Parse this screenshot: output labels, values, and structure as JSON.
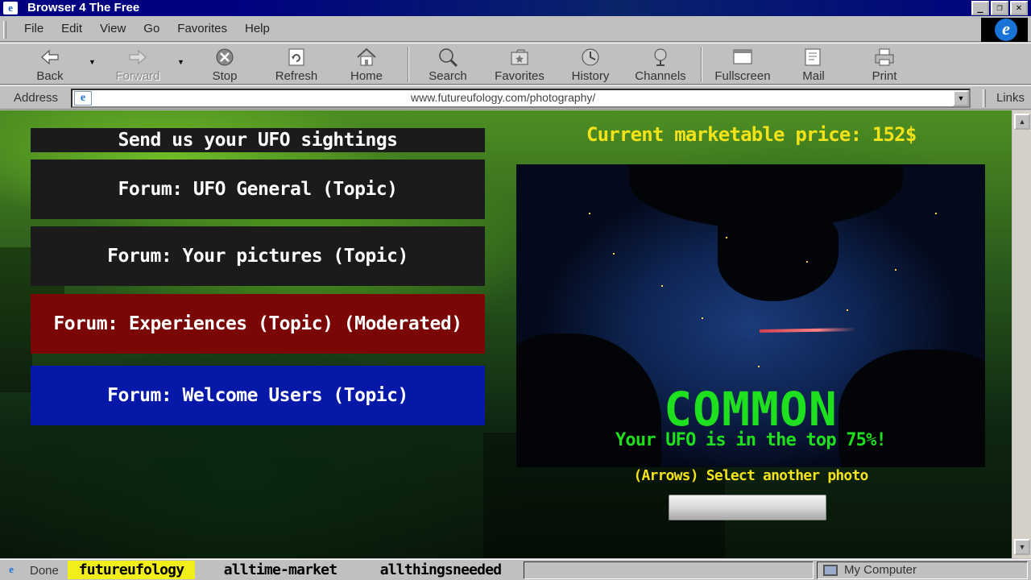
{
  "window": {
    "title": "Browser 4 The Free",
    "buttons": [
      "_",
      "❐",
      "✕"
    ]
  },
  "menu": {
    "items": [
      "File",
      "Edit",
      "View",
      "Go",
      "Favorites",
      "Help"
    ]
  },
  "toolbar": {
    "back": "Back",
    "forward": "Forward",
    "stop": "Stop",
    "refresh": "Refresh",
    "home": "Home",
    "search": "Search",
    "favorites": "Favorites",
    "history": "History",
    "channels": "Channels",
    "fullscreen": "Fullscreen",
    "mail": "Mail",
    "print": "Print"
  },
  "address": {
    "label": "Address",
    "url": "www.futureufology.com/photography/",
    "links": "Links"
  },
  "page": {
    "sightings_title": "Send us your UFO sightings",
    "forums": [
      {
        "label": "Forum: UFO General (Topic)",
        "color": "#1b1b1b"
      },
      {
        "label": "Forum: Your pictures (Topic)",
        "color": "#1b1b1b"
      },
      {
        "label": "Forum: Experiences (Topic) (Moderated)",
        "color": "#7a0606"
      },
      {
        "label": "Forum: Welcome Users (Topic)",
        "color": "#0518a8"
      }
    ],
    "price": "Current marketable price: 152$",
    "rarity": "COMMON",
    "rank": "Your UFO is in the top 75%!",
    "hint": "(Arrows) Select another photo",
    "accent_yellow": "#f2e21a",
    "accent_green": "#1ee01e"
  },
  "status": {
    "text": "Done",
    "tags": [
      "futureufology",
      "alltime-market",
      "allthingsneeded"
    ],
    "zone": "My Computer"
  }
}
